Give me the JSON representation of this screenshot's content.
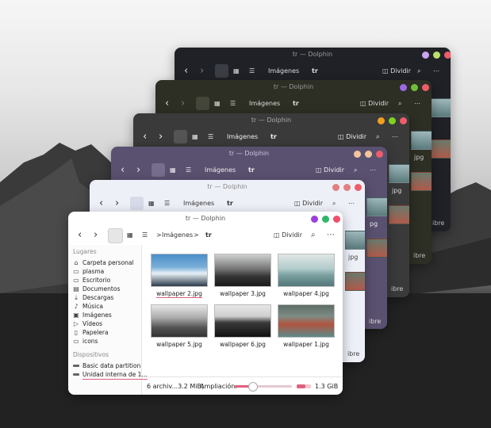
{
  "app": {
    "window_title": "tr — Dolphin"
  },
  "toolbar": {
    "breadcrumb_parent": "Imágenes",
    "breadcrumb_sep": ">",
    "breadcrumb_current": "tr",
    "split_label": "Dividir",
    "back_glyph": "‹",
    "forward_glyph": "›"
  },
  "sidebar": {
    "places_header": "Lugares",
    "places": [
      {
        "label": "Carpeta personal",
        "icon": "home-icon"
      },
      {
        "label": "plasma",
        "icon": "folder-icon"
      },
      {
        "label": "Escritorio",
        "icon": "desktop-icon"
      },
      {
        "label": "Documentos",
        "icon": "documents-icon"
      },
      {
        "label": "Descargas",
        "icon": "download-icon"
      },
      {
        "label": "Música",
        "icon": "music-icon"
      },
      {
        "label": "Imágenes",
        "icon": "pictures-icon"
      },
      {
        "label": "Vídeos",
        "icon": "video-icon"
      },
      {
        "label": "Papelera",
        "icon": "trash-icon"
      },
      {
        "label": "icons",
        "icon": "folder-icon"
      }
    ],
    "devices_header": "Dispositivos",
    "devices": [
      {
        "label": "Basic data partition",
        "icon": "drive-icon"
      },
      {
        "label": "Unidad interna de 1...",
        "icon": "drive-icon"
      }
    ]
  },
  "files": [
    {
      "name": "wallpaper 2.jpg"
    },
    {
      "name": "wallpaper 3.jpg"
    },
    {
      "name": "wallpaper 4.jpg"
    },
    {
      "name": "wallpaper 5.jpg"
    },
    {
      "name": "wallpaper 6.jpg"
    },
    {
      "name": "wallpaper 1.jpg"
    }
  ],
  "status": {
    "summary": "6 archiv...3.2 MiB)",
    "zoom_label": "Ampliación:",
    "zoom_level": 0.3,
    "free_space": "1.3 GiB libre"
  },
  "stack_partial": {
    "free_fragment": "ibre",
    "label_fragment": "jpg",
    "label_fragment2": "pg"
  },
  "colors": {
    "accent": "#e0607e",
    "front_bg": "#ffffff",
    "win5_bg": "#eef0f8",
    "win4_bg": "#5a5170",
    "win3_bg": "#3a3a3a",
    "win2_bg": "#2d2e24",
    "win1_bg": "#1f2126"
  }
}
